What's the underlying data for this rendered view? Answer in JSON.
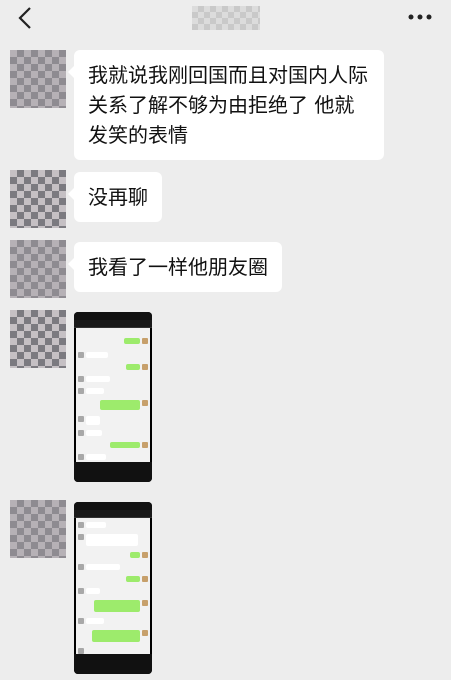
{
  "header": {
    "back_icon": "chevron-left-icon",
    "more_icon": "more-dots-icon"
  },
  "messages": [
    {
      "text": "我就说我刚回国而且对国内人际关系了解不够为由拒绝了 他就发笑的表情"
    },
    {
      "text": "没再聊"
    },
    {
      "text": "我看了一样他朋友圈"
    }
  ]
}
